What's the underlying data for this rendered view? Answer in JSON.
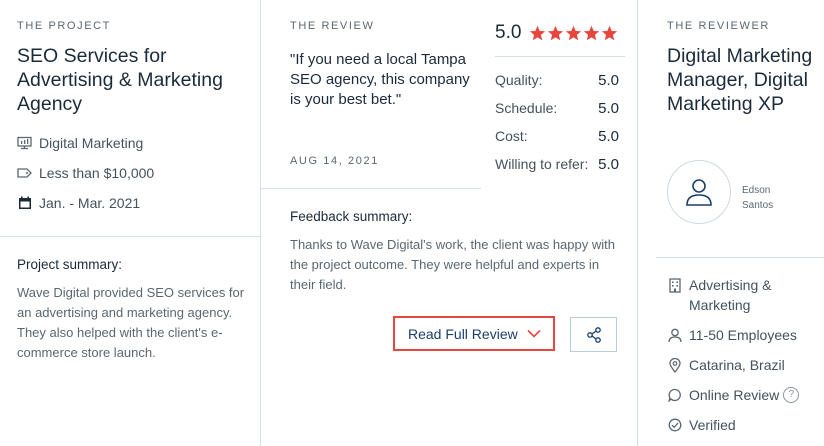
{
  "project": {
    "eyebrow": "THE PROJECT",
    "title": "SEO Services for Advertising & Marketing Agency",
    "meta": [
      {
        "icon": "monitor-icon",
        "text": "Digital Marketing"
      },
      {
        "icon": "price-tag-icon",
        "text": "Less than $10,000"
      },
      {
        "icon": "calendar-icon",
        "text": "Jan. - Mar. 2021"
      }
    ],
    "summary_label": "Project summary:",
    "summary_text": "Wave Digital provided SEO services for an advertising and marketing agency. They also helped with the client's e-commerce store launch."
  },
  "review": {
    "eyebrow": "THE REVIEW",
    "quote": "\"If you need a local Tampa SEO agency, this company is your best bet.\"",
    "date": "AUG 14, 2021",
    "overall": "5.0",
    "stars": 5,
    "scores": [
      {
        "label": "Quality:",
        "value": "5.0"
      },
      {
        "label": "Schedule:",
        "value": "5.0"
      },
      {
        "label": "Cost:",
        "value": "5.0"
      },
      {
        "label": "Willing to refer:",
        "value": "5.0"
      }
    ],
    "feedback_label": "Feedback summary:",
    "feedback_text": "Thanks to Wave Digital's work, the client was happy with the project outcome. They were helpful and experts in their field.",
    "read_button_label": "Read Full Review"
  },
  "reviewer": {
    "eyebrow": "THE REVIEWER",
    "title": "Digital Marketing Manager, Digital Marketing XP",
    "name": "Edson Santos",
    "details": [
      {
        "icon": "building-icon",
        "text": "Advertising & Marketing"
      },
      {
        "icon": "person-icon",
        "text": "11-50 Employees"
      },
      {
        "icon": "location-pin-icon",
        "text": "Catarina, Brazil"
      },
      {
        "icon": "chat-bubble-icon",
        "text": "Online Review",
        "help": "?"
      },
      {
        "icon": "check-circle-icon",
        "text": "Verified"
      }
    ]
  },
  "colors": {
    "star": "#e8453c",
    "highlight_border": "#e8453c",
    "link": "#1a3d6e",
    "divider": "#d6e0e6"
  }
}
